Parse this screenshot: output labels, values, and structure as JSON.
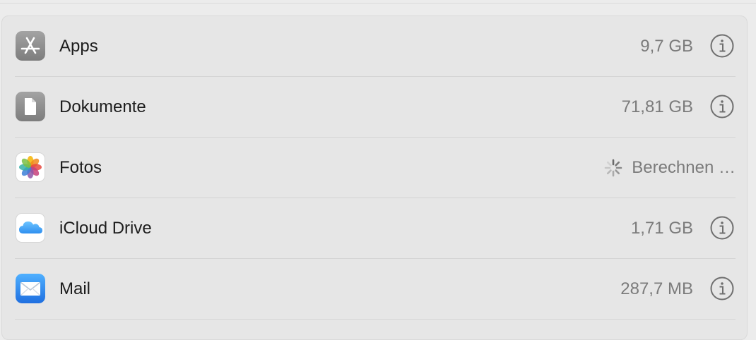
{
  "storage": {
    "rows": [
      {
        "label": "Apps",
        "size": "9,7 GB",
        "icon": "app-store-icon"
      },
      {
        "label": "Dokumente",
        "size": "71,81 GB",
        "icon": "document-icon"
      },
      {
        "label": "Fotos",
        "status": "Berechnen …",
        "icon": "photos-icon"
      },
      {
        "label": "iCloud Drive",
        "size": "1,71 GB",
        "icon": "icloud-icon"
      },
      {
        "label": "Mail",
        "size": "287,7 MB",
        "icon": "mail-icon"
      }
    ]
  }
}
